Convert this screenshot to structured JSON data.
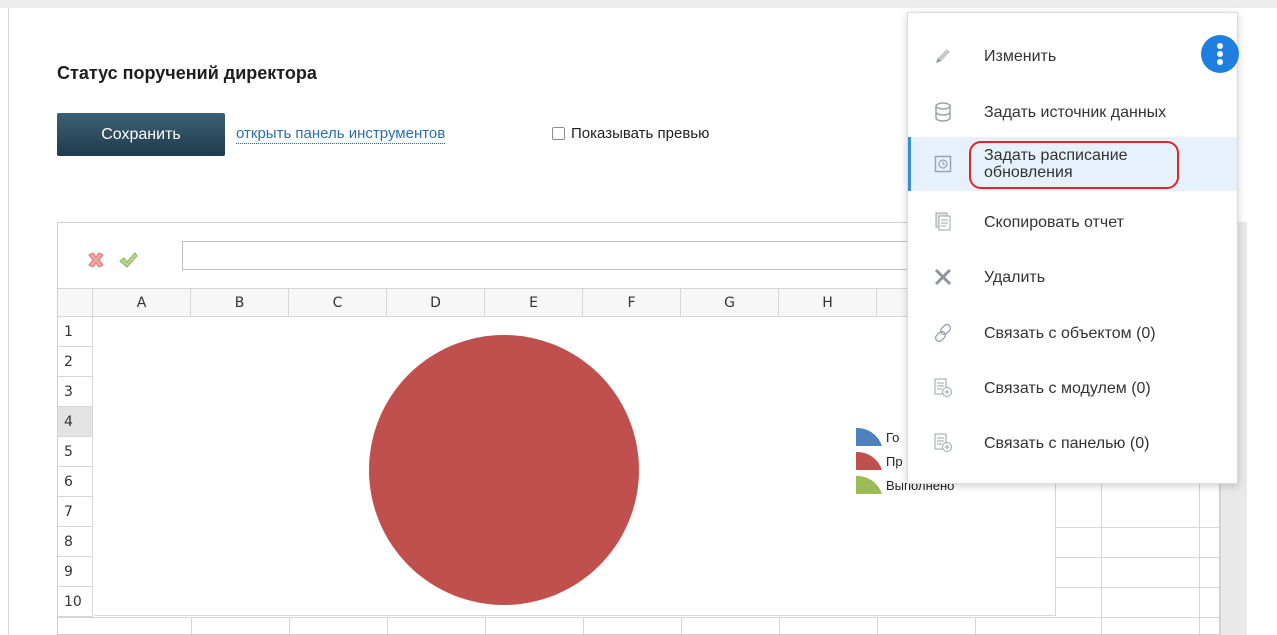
{
  "page": {
    "title": "Статус поручений директора"
  },
  "actions": {
    "save_label": "Сохранить",
    "toolbar_link": "открыть панель инструментов",
    "preview_label": "Показывать превью",
    "preview_checked": false
  },
  "sheet": {
    "columns": [
      "A",
      "B",
      "C",
      "D",
      "E",
      "F",
      "G",
      "H"
    ],
    "rows": [
      "1",
      "2",
      "3",
      "4",
      "5",
      "6",
      "7",
      "8",
      "9",
      "10"
    ],
    "selected_row": "4"
  },
  "chart_data": {
    "type": "pie",
    "title": "",
    "slices": [
      {
        "label": "Го",
        "value": 0,
        "color": "#4f81bd"
      },
      {
        "label": "Пр",
        "value": 100,
        "color": "#c0504d"
      },
      {
        "label": "Выполнено",
        "value": 0,
        "color": "#9bbb59"
      }
    ],
    "legend_position": "right"
  },
  "menu": {
    "items": [
      {
        "label": "Изменить",
        "icon": "pencil-icon"
      },
      {
        "label": "Задать источник данных",
        "icon": "database-icon"
      },
      {
        "label": "Задать расписание обновления",
        "icon": "schedule-icon",
        "active": true
      },
      {
        "label": "Скопировать отчет",
        "icon": "copy-icon"
      },
      {
        "label": "Удалить",
        "icon": "close-icon"
      },
      {
        "label": "Связать с объектом (0)",
        "icon": "link-icon"
      },
      {
        "label": "Связать с модулем (0)",
        "icon": "module-icon"
      },
      {
        "label": "Связать с панелью (0)",
        "icon": "panel-icon"
      }
    ]
  },
  "colors": {
    "accent": "#1e7fe0",
    "highlight": "#e0242b",
    "save_button": "#2b4a5d"
  }
}
